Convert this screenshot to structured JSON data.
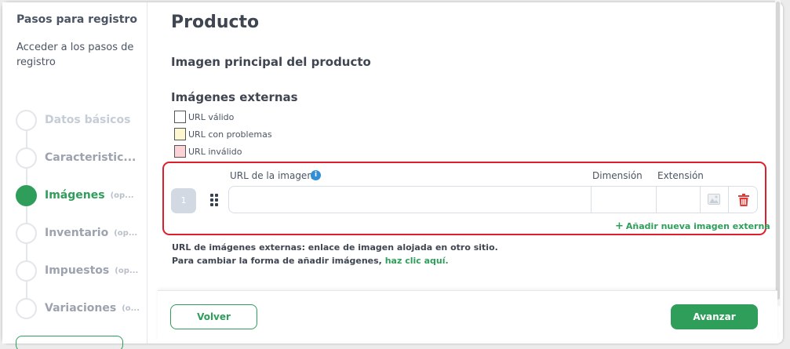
{
  "sidebar": {
    "title": "Pasos para registro",
    "subtitle": "Acceder a los pasos de registro",
    "steps": [
      {
        "label": "Datos básicos",
        "optional": "",
        "state": "done"
      },
      {
        "label": "Caracteristic...",
        "optional": "",
        "state": "pending"
      },
      {
        "label": "Imágenes",
        "optional": "(op...",
        "state": "active"
      },
      {
        "label": "Inventario",
        "optional": "(op...",
        "state": "pending"
      },
      {
        "label": "Impuestos",
        "optional": "(op...",
        "state": "pending"
      },
      {
        "label": "Variaciones",
        "optional": "(o...",
        "state": "pending"
      }
    ]
  },
  "main": {
    "title": "Producto",
    "main_image_heading": "Imagen principal del producto",
    "external_images_heading": "Imágenes externas",
    "legend": [
      {
        "label": "URL válido",
        "color": "#ffffff"
      },
      {
        "label": "URL con problemas",
        "color": "#fff7d1"
      },
      {
        "label": "URL inválido",
        "color": "#fbd3d6"
      }
    ],
    "table": {
      "col_url": "URL de la imagen",
      "col_dimension": "Dimensión",
      "col_extension": "Extensión",
      "row_number": "1",
      "url_value": "",
      "info_icon": "i"
    },
    "add_link": "Añadir nueva imagen externa",
    "add_plus": "+",
    "note_line1": "URL de imágenes externas: enlace de imagen alojada en otro sitio.",
    "note_line2_prefix": "Para cambiar la forma de añadir imágenes,",
    "note_line2_link": "haz clic aquí."
  },
  "footer": {
    "back_label": "Volver",
    "next_label": "Avanzar"
  },
  "colors": {
    "accent": "#2f9e5b",
    "highlight_border": "#dc1f2c",
    "info": "#2f8fd8",
    "danger": "#e53935"
  }
}
